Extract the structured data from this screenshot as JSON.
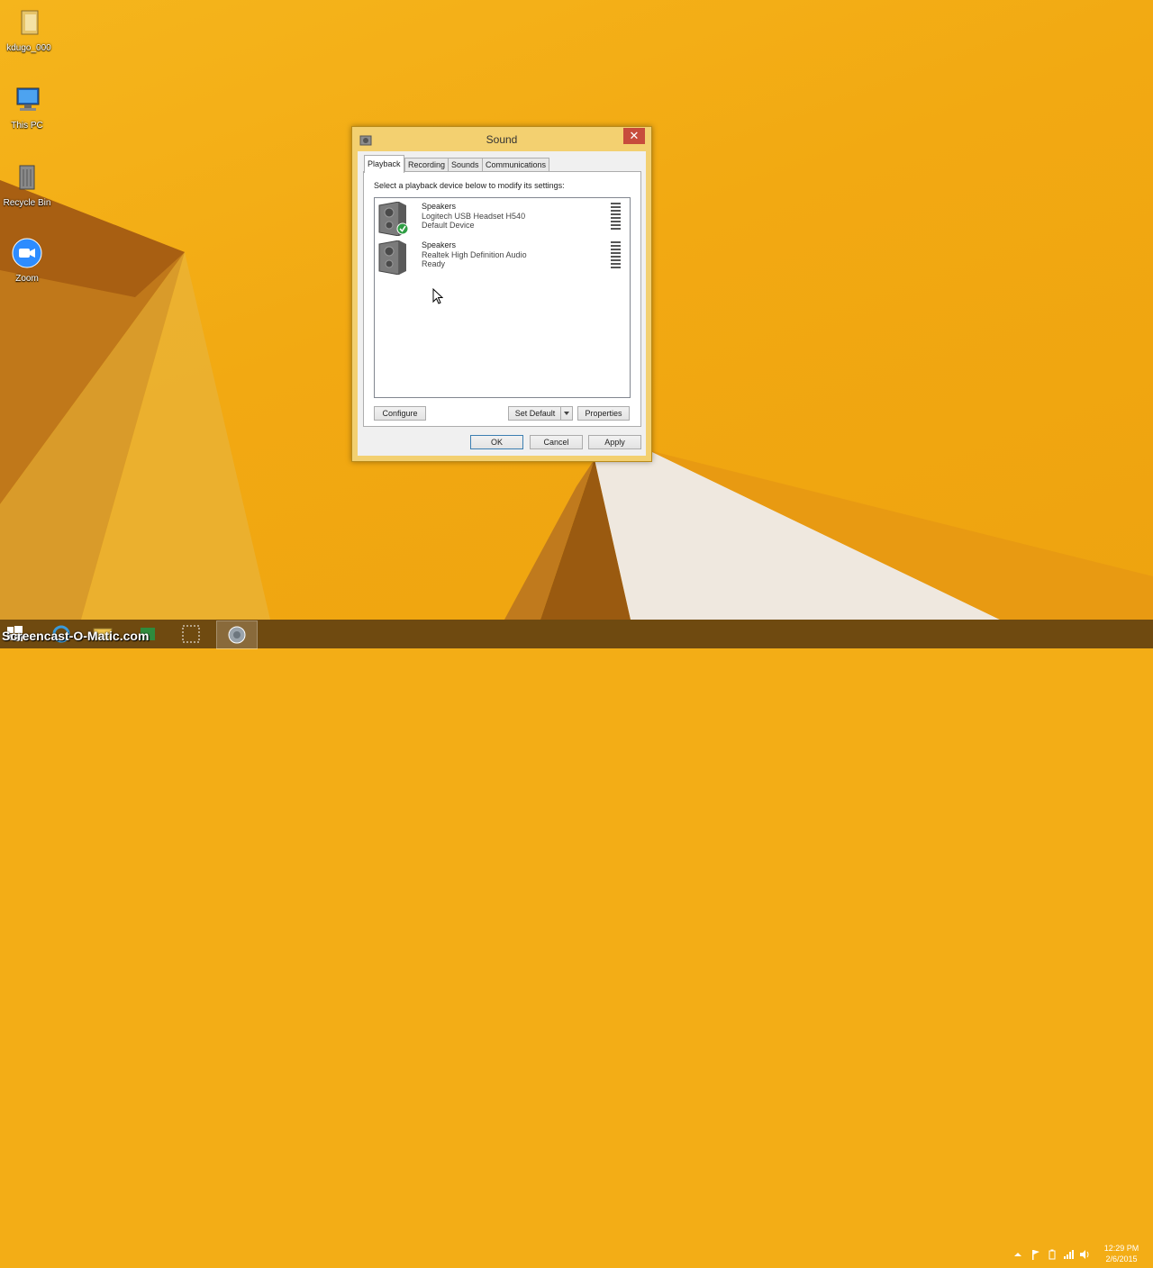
{
  "desktop": {
    "icons": [
      {
        "label": "kdugo_000",
        "icon": "folder-icon"
      },
      {
        "label": "This PC",
        "icon": "computer-icon"
      },
      {
        "label": "Recycle Bin",
        "icon": "recycle-bin-icon"
      },
      {
        "label": "Zoom",
        "icon": "zoom-icon"
      }
    ]
  },
  "dialog": {
    "title": "Sound",
    "close_label": "✕",
    "tabs": [
      {
        "label": "Playback",
        "selected": true
      },
      {
        "label": "Recording"
      },
      {
        "label": "Sounds"
      },
      {
        "label": "Communications"
      }
    ],
    "prompt": "Select a playback device below to modify its settings:",
    "devices": [
      {
        "name": "Speakers",
        "driver": "Logitech USB Headset H540",
        "status": "Default Device",
        "default": true
      },
      {
        "name": "Speakers",
        "driver": "Realtek High Definition Audio",
        "status": "Ready",
        "default": false
      }
    ],
    "buttons": {
      "configure": "Configure",
      "set_default": "Set Default",
      "properties": "Properties",
      "ok": "OK",
      "cancel": "Cancel",
      "apply": "Apply"
    }
  },
  "taskbar": {
    "watermark": "Screencast-O-Matic.com",
    "clock_time": "12:29 PM",
    "clock_date": "2/6/2015"
  },
  "colors": {
    "desktop_bg": "#f3ad16",
    "taskbar": "#6f4a10",
    "dialog_frame": "#f3d070",
    "close_button": "#c74c3c"
  }
}
